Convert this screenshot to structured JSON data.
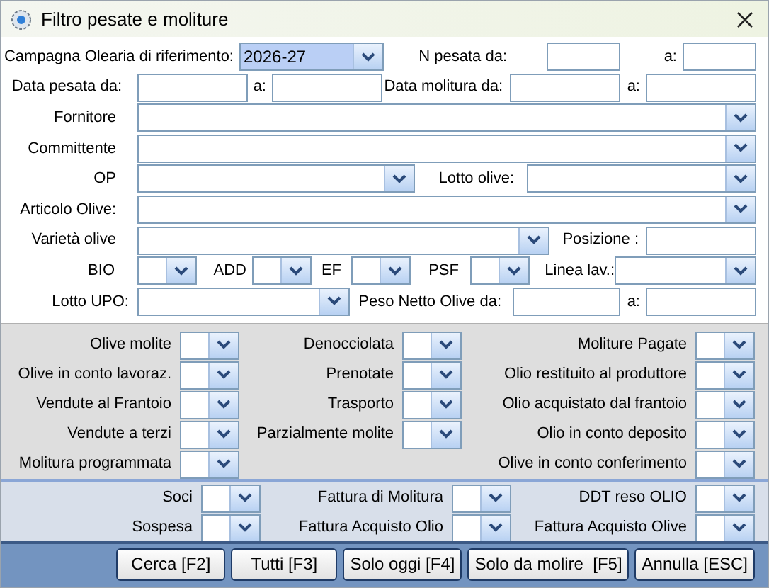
{
  "window": {
    "title": "Filtro pesate e moliture"
  },
  "top_rows": [
    [
      {
        "kind": "label",
        "text": "Campagna Olearia di riferimento:"
      },
      {
        "kind": "combo",
        "value": "2026-27",
        "selected": true
      },
      {
        "kind": "label",
        "text": "N pesata da:"
      },
      {
        "kind": "input",
        "selected": false
      },
      {
        "kind": "label",
        "text": "a:"
      },
      {
        "kind": "input",
        "selected": false
      }
    ],
    [
      {
        "kind": "label",
        "text": "Data pesata da:"
      },
      {
        "kind": "input",
        "selected": false
      },
      {
        "kind": "label",
        "text": "a:"
      },
      {
        "kind": "input",
        "selected": false
      },
      {
        "kind": "label",
        "text": "Data molitura da:"
      },
      {
        "kind": "input",
        "selected": false
      },
      {
        "kind": "label",
        "text": "a:"
      },
      {
        "kind": "input",
        "selected": false
      }
    ],
    [
      {
        "kind": "label",
        "text": "Fornitore"
      },
      {
        "kind": "combo",
        "selected": false
      }
    ],
    [
      {
        "kind": "label",
        "text": "Committente"
      },
      {
        "kind": "combo",
        "selected": false
      }
    ],
    [
      {
        "kind": "label",
        "text": "OP"
      },
      {
        "kind": "combo",
        "selected": false
      },
      {
        "kind": "label",
        "text": "Lotto olive:"
      },
      {
        "kind": "combo",
        "selected": false
      }
    ],
    [
      {
        "kind": "label",
        "text": "Articolo Olive:"
      },
      {
        "kind": "combo",
        "selected": false
      }
    ],
    [
      {
        "kind": "label",
        "text": "Varietà olive"
      },
      {
        "kind": "combo",
        "selected": false
      },
      {
        "kind": "label",
        "text": "Posizione :"
      },
      {
        "kind": "input",
        "selected": false
      }
    ],
    [
      {
        "kind": "label",
        "text": "BIO"
      },
      {
        "kind": "combo",
        "selected": false
      },
      {
        "kind": "label",
        "text": "ADD"
      },
      {
        "kind": "combo",
        "selected": false
      },
      {
        "kind": "label",
        "text": "EF"
      },
      {
        "kind": "combo",
        "selected": false
      },
      {
        "kind": "label",
        "text": "PSF"
      },
      {
        "kind": "combo",
        "selected": false
      },
      {
        "kind": "label",
        "text": "Linea lav.:"
      },
      {
        "kind": "combo",
        "selected": false
      }
    ],
    [
      {
        "kind": "label",
        "text": "Lotto UPO:"
      },
      {
        "kind": "combo",
        "selected": false
      },
      {
        "kind": "label",
        "text": "Peso Netto Olive da:"
      },
      {
        "kind": "input",
        "selected": false
      },
      {
        "kind": "label",
        "text": "a:"
      },
      {
        "kind": "input",
        "selected": false
      }
    ]
  ],
  "flag_columns": [
    [
      "Olive molite",
      "Olive in conto lavoraz.",
      "Vendute al Frantoio",
      "Vendute a terzi",
      "Molitura programmata"
    ],
    [
      "Denocciolata",
      "Prenotate",
      "Trasporto",
      "Parzialmente molite"
    ],
    [
      "Moliture Pagate",
      "Olio restituito al produttore",
      "Olio acquistato dal frantoio",
      "Olio in conto deposito",
      "Olive in conto conferimento"
    ]
  ],
  "document_columns": [
    [
      "Soci",
      "Sospesa"
    ],
    [
      "Fattura di Molitura",
      "Fattura Acquisto Olio"
    ],
    [
      "DDT reso OLIO",
      "Fattura Acquisto Olive"
    ]
  ],
  "buttons": [
    "Cerca [F2]",
    "Tutti [F3]",
    "Solo oggi [F4]",
    "Solo da molire  [F5]",
    "Annulla [ESC]"
  ]
}
